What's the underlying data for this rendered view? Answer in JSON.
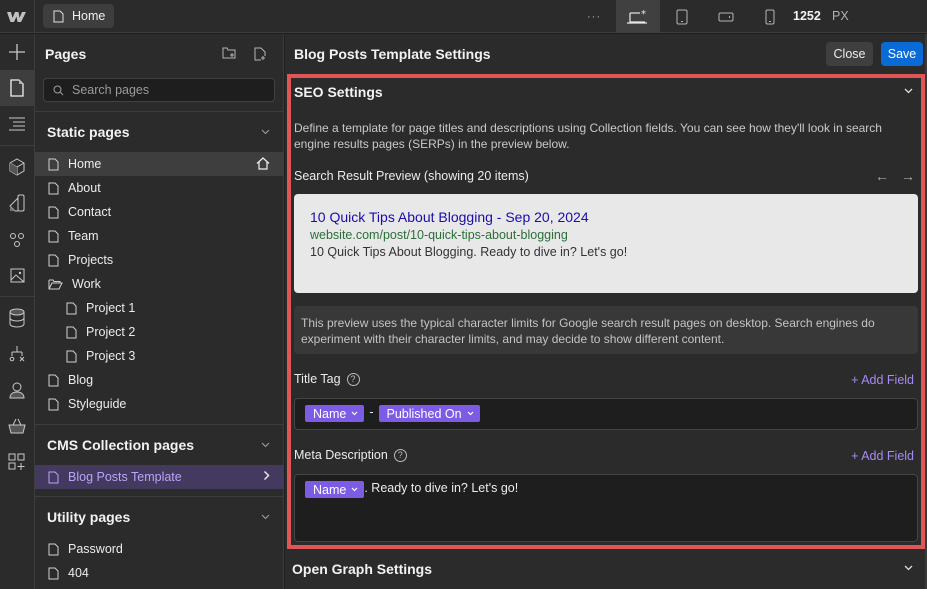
{
  "topbar": {
    "logo": "W",
    "page_tab": "Home",
    "more_label": "···",
    "breakpoints": [
      {
        "name": "desktop-base",
        "icon": "laptop-star-icon",
        "active": true
      },
      {
        "name": "tablet",
        "icon": "tablet-icon",
        "active": false
      },
      {
        "name": "mobile-landscape",
        "icon": "mobile-landscape-icon",
        "active": false
      },
      {
        "name": "mobile-portrait",
        "icon": "mobile-portrait-icon",
        "active": false
      }
    ],
    "canvas_width": "1252",
    "canvas_unit": "PX"
  },
  "rail": {
    "items": [
      {
        "name": "add-icon"
      },
      {
        "name": "pages-icon",
        "active": true
      },
      {
        "name": "navigator-icon"
      },
      {
        "name": "components-icon"
      },
      {
        "name": "styles-icon"
      },
      {
        "name": "variables-icon"
      },
      {
        "name": "assets-icon"
      },
      {
        "name": "cms-icon"
      },
      {
        "name": "logic-icon"
      },
      {
        "name": "users-icon"
      },
      {
        "name": "ecommerce-icon"
      },
      {
        "name": "apps-icon"
      }
    ]
  },
  "pages_panel": {
    "title": "Pages",
    "search_placeholder": "Search pages",
    "static": {
      "title": "Static pages",
      "items": [
        {
          "label": "Home",
          "type": "page",
          "selected": true,
          "home": true
        },
        {
          "label": "About",
          "type": "page"
        },
        {
          "label": "Contact",
          "type": "page"
        },
        {
          "label": "Team",
          "type": "page"
        },
        {
          "label": "Projects",
          "type": "page"
        },
        {
          "label": "Work",
          "type": "folder"
        },
        {
          "label": "Project 1",
          "type": "page",
          "sub": true
        },
        {
          "label": "Project 2",
          "type": "page",
          "sub": true
        },
        {
          "label": "Project 3",
          "type": "page",
          "sub": true
        },
        {
          "label": "Blog",
          "type": "page"
        },
        {
          "label": "Styleguide",
          "type": "page"
        }
      ]
    },
    "cms": {
      "title": "CMS Collection pages",
      "items": [
        {
          "label": "Blog Posts Template",
          "selected": true
        }
      ]
    },
    "utility": {
      "title": "Utility pages",
      "items": [
        {
          "label": "Password"
        },
        {
          "label": "404"
        }
      ]
    }
  },
  "settings": {
    "title": "Blog Posts Template Settings",
    "close_label": "Close",
    "save_label": "Save",
    "seo": {
      "title": "SEO Settings",
      "description": "Define a template for page titles and descriptions using Collection fields. You can see how they'll look in search engine results pages (SERPs) in the preview below.",
      "preview_label": "Search Result Preview (showing 20 items)",
      "serp": {
        "title": "10 Quick Tips About Blogging - Sep 20, 2024",
        "url": "website.com/post/10-quick-tips-about-blogging",
        "description": "10 Quick Tips About Blogging. Ready to dive in? Let's go!"
      },
      "notice": "This preview uses the typical character limits for Google search result pages on desktop. Search engines do experiment with their character limits, and may decide to show different content.",
      "title_tag": {
        "label": "Title Tag",
        "add_field": "+ Add Field",
        "pill1": "Name",
        "separator": "-",
        "pill2": "Published On"
      },
      "meta_description": {
        "label": "Meta Description",
        "add_field": "+ Add Field",
        "pill1": "Name",
        "text": ". Ready to dive in? Let's go!"
      }
    },
    "open_graph": {
      "title": "Open Graph Settings"
    }
  },
  "colors": {
    "accent_blue": "#0a6bd7",
    "pill_purple": "#7c5ce4",
    "highlight_red": "#e05555",
    "link_purple": "#a58bf2"
  }
}
